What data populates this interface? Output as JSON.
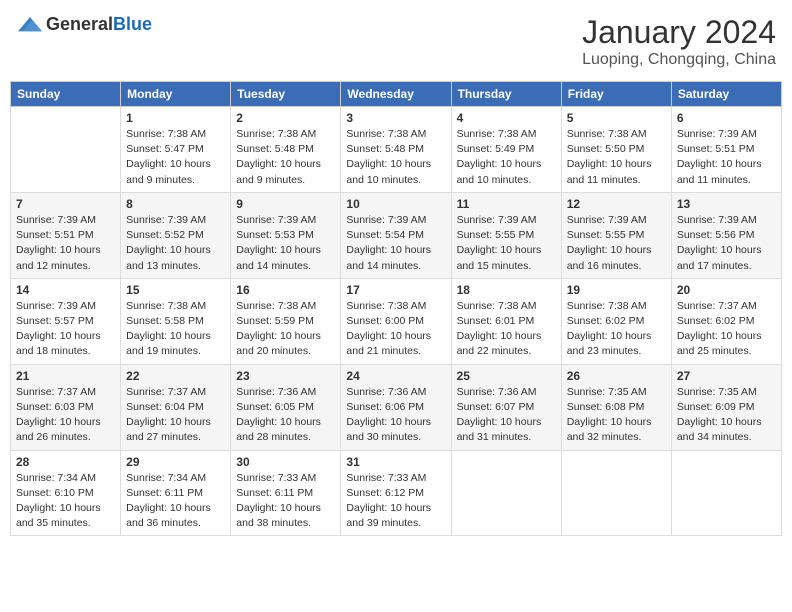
{
  "header": {
    "logo_general": "General",
    "logo_blue": "Blue",
    "month_year": "January 2024",
    "location": "Luoping, Chongqing, China"
  },
  "weekdays": [
    "Sunday",
    "Monday",
    "Tuesday",
    "Wednesday",
    "Thursday",
    "Friday",
    "Saturday"
  ],
  "weeks": [
    [
      {
        "day": "",
        "sunrise": "",
        "sunset": "",
        "daylight": ""
      },
      {
        "day": "1",
        "sunrise": "Sunrise: 7:38 AM",
        "sunset": "Sunset: 5:47 PM",
        "daylight": "Daylight: 10 hours and 9 minutes."
      },
      {
        "day": "2",
        "sunrise": "Sunrise: 7:38 AM",
        "sunset": "Sunset: 5:48 PM",
        "daylight": "Daylight: 10 hours and 9 minutes."
      },
      {
        "day": "3",
        "sunrise": "Sunrise: 7:38 AM",
        "sunset": "Sunset: 5:48 PM",
        "daylight": "Daylight: 10 hours and 10 minutes."
      },
      {
        "day": "4",
        "sunrise": "Sunrise: 7:38 AM",
        "sunset": "Sunset: 5:49 PM",
        "daylight": "Daylight: 10 hours and 10 minutes."
      },
      {
        "day": "5",
        "sunrise": "Sunrise: 7:38 AM",
        "sunset": "Sunset: 5:50 PM",
        "daylight": "Daylight: 10 hours and 11 minutes."
      },
      {
        "day": "6",
        "sunrise": "Sunrise: 7:39 AM",
        "sunset": "Sunset: 5:51 PM",
        "daylight": "Daylight: 10 hours and 11 minutes."
      }
    ],
    [
      {
        "day": "7",
        "sunrise": "Sunrise: 7:39 AM",
        "sunset": "Sunset: 5:51 PM",
        "daylight": "Daylight: 10 hours and 12 minutes."
      },
      {
        "day": "8",
        "sunrise": "Sunrise: 7:39 AM",
        "sunset": "Sunset: 5:52 PM",
        "daylight": "Daylight: 10 hours and 13 minutes."
      },
      {
        "day": "9",
        "sunrise": "Sunrise: 7:39 AM",
        "sunset": "Sunset: 5:53 PM",
        "daylight": "Daylight: 10 hours and 14 minutes."
      },
      {
        "day": "10",
        "sunrise": "Sunrise: 7:39 AM",
        "sunset": "Sunset: 5:54 PM",
        "daylight": "Daylight: 10 hours and 14 minutes."
      },
      {
        "day": "11",
        "sunrise": "Sunrise: 7:39 AM",
        "sunset": "Sunset: 5:55 PM",
        "daylight": "Daylight: 10 hours and 15 minutes."
      },
      {
        "day": "12",
        "sunrise": "Sunrise: 7:39 AM",
        "sunset": "Sunset: 5:55 PM",
        "daylight": "Daylight: 10 hours and 16 minutes."
      },
      {
        "day": "13",
        "sunrise": "Sunrise: 7:39 AM",
        "sunset": "Sunset: 5:56 PM",
        "daylight": "Daylight: 10 hours and 17 minutes."
      }
    ],
    [
      {
        "day": "14",
        "sunrise": "Sunrise: 7:39 AM",
        "sunset": "Sunset: 5:57 PM",
        "daylight": "Daylight: 10 hours and 18 minutes."
      },
      {
        "day": "15",
        "sunrise": "Sunrise: 7:38 AM",
        "sunset": "Sunset: 5:58 PM",
        "daylight": "Daylight: 10 hours and 19 minutes."
      },
      {
        "day": "16",
        "sunrise": "Sunrise: 7:38 AM",
        "sunset": "Sunset: 5:59 PM",
        "daylight": "Daylight: 10 hours and 20 minutes."
      },
      {
        "day": "17",
        "sunrise": "Sunrise: 7:38 AM",
        "sunset": "Sunset: 6:00 PM",
        "daylight": "Daylight: 10 hours and 21 minutes."
      },
      {
        "day": "18",
        "sunrise": "Sunrise: 7:38 AM",
        "sunset": "Sunset: 6:01 PM",
        "daylight": "Daylight: 10 hours and 22 minutes."
      },
      {
        "day": "19",
        "sunrise": "Sunrise: 7:38 AM",
        "sunset": "Sunset: 6:02 PM",
        "daylight": "Daylight: 10 hours and 23 minutes."
      },
      {
        "day": "20",
        "sunrise": "Sunrise: 7:37 AM",
        "sunset": "Sunset: 6:02 PM",
        "daylight": "Daylight: 10 hours and 25 minutes."
      }
    ],
    [
      {
        "day": "21",
        "sunrise": "Sunrise: 7:37 AM",
        "sunset": "Sunset: 6:03 PM",
        "daylight": "Daylight: 10 hours and 26 minutes."
      },
      {
        "day": "22",
        "sunrise": "Sunrise: 7:37 AM",
        "sunset": "Sunset: 6:04 PM",
        "daylight": "Daylight: 10 hours and 27 minutes."
      },
      {
        "day": "23",
        "sunrise": "Sunrise: 7:36 AM",
        "sunset": "Sunset: 6:05 PM",
        "daylight": "Daylight: 10 hours and 28 minutes."
      },
      {
        "day": "24",
        "sunrise": "Sunrise: 7:36 AM",
        "sunset": "Sunset: 6:06 PM",
        "daylight": "Daylight: 10 hours and 30 minutes."
      },
      {
        "day": "25",
        "sunrise": "Sunrise: 7:36 AM",
        "sunset": "Sunset: 6:07 PM",
        "daylight": "Daylight: 10 hours and 31 minutes."
      },
      {
        "day": "26",
        "sunrise": "Sunrise: 7:35 AM",
        "sunset": "Sunset: 6:08 PM",
        "daylight": "Daylight: 10 hours and 32 minutes."
      },
      {
        "day": "27",
        "sunrise": "Sunrise: 7:35 AM",
        "sunset": "Sunset: 6:09 PM",
        "daylight": "Daylight: 10 hours and 34 minutes."
      }
    ],
    [
      {
        "day": "28",
        "sunrise": "Sunrise: 7:34 AM",
        "sunset": "Sunset: 6:10 PM",
        "daylight": "Daylight: 10 hours and 35 minutes."
      },
      {
        "day": "29",
        "sunrise": "Sunrise: 7:34 AM",
        "sunset": "Sunset: 6:11 PM",
        "daylight": "Daylight: 10 hours and 36 minutes."
      },
      {
        "day": "30",
        "sunrise": "Sunrise: 7:33 AM",
        "sunset": "Sunset: 6:11 PM",
        "daylight": "Daylight: 10 hours and 38 minutes."
      },
      {
        "day": "31",
        "sunrise": "Sunrise: 7:33 AM",
        "sunset": "Sunset: 6:12 PM",
        "daylight": "Daylight: 10 hours and 39 minutes."
      },
      {
        "day": "",
        "sunrise": "",
        "sunset": "",
        "daylight": ""
      },
      {
        "day": "",
        "sunrise": "",
        "sunset": "",
        "daylight": ""
      },
      {
        "day": "",
        "sunrise": "",
        "sunset": "",
        "daylight": ""
      }
    ]
  ]
}
